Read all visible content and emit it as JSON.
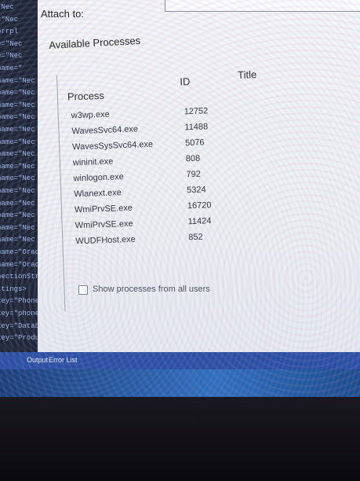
{
  "dialog": {
    "attach_to_label": "Attach to:",
    "attach_to_value": "",
    "available_processes_label": "Available Processes",
    "columns": {
      "process": "Process",
      "id": "ID",
      "title": "Title"
    },
    "processes": [
      {
        "name": "w3wp.exe",
        "id": "12752"
      },
      {
        "name": "WavesSvc64.exe",
        "id": "11488"
      },
      {
        "name": "WavesSysSvc64.exe",
        "id": "5076"
      },
      {
        "name": "wininit.exe",
        "id": "808"
      },
      {
        "name": "winlogon.exe",
        "id": "792"
      },
      {
        "name": "Wlanext.exe",
        "id": "5324"
      },
      {
        "name": "WmiPrvSE.exe",
        "id": "16720"
      },
      {
        "name": "WmiPrvSE.exe",
        "id": "11424"
      },
      {
        "name": "WUDFHost.exe",
        "id": "852"
      }
    ],
    "show_all_users_label": "Show processes from all users"
  },
  "code_lines": [
    "\"Nec",
    "=\"Nec",
    "orrpl",
    "e=\"Nec",
    "e=\"Nec",
    "name=\"",
    "name=\"Nec",
    "name=\"Nec",
    "name=\"Nec",
    "name=\"Nec",
    "name=\"Nec",
    "name=\"Nec",
    "name=\"Nec",
    "name=\"Nec",
    "name=\"Nec",
    "name=\"Nec",
    "name=\"Nec",
    "name=\"Nec",
    "name=\"Nec",
    "name=\"Nec",
    "name=\"Oracle",
    "name=\"Oracle",
    "nectionStrings",
    "ttings>",
    "key=\"Phone",
    "key=\"phone",
    "key=\"Datab",
    "key=\"Product"
  ],
  "status_bar": {
    "tab_output": "Output",
    "tab_error_list": "Error List"
  },
  "colors": {
    "screen_bg": "#f3f4f6",
    "code_bg": "#1e2638",
    "vs_bar": "#2b4fa3",
    "taskbar": "#2f6fbf"
  }
}
